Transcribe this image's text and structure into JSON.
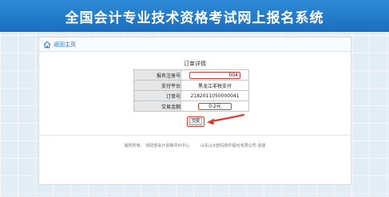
{
  "header": {
    "title": "全国会计专业技术资格考试网上报名系统"
  },
  "breadcrumb": {
    "home_label": "返回主页"
  },
  "order": {
    "title": "订单详情",
    "rows": [
      {
        "label": "报名注册号",
        "value": "004"
      },
      {
        "label": "支付平台",
        "value": "黑龙江非税支付"
      },
      {
        "label": "订单号",
        "value": "2182011050000041"
      },
      {
        "label": "交易金额",
        "value": "0.2元"
      }
    ]
  },
  "pay_button_label": "交费",
  "footer": {
    "copyright": "版权所有：  财政部会计资格评价中心",
    "developer": "山东山大鸥玛软件股份有限公司 承建"
  },
  "colors": {
    "header_blue": "#1f74c4",
    "highlight_red": "#e23b2e",
    "link_blue": "#2a6fbf"
  }
}
